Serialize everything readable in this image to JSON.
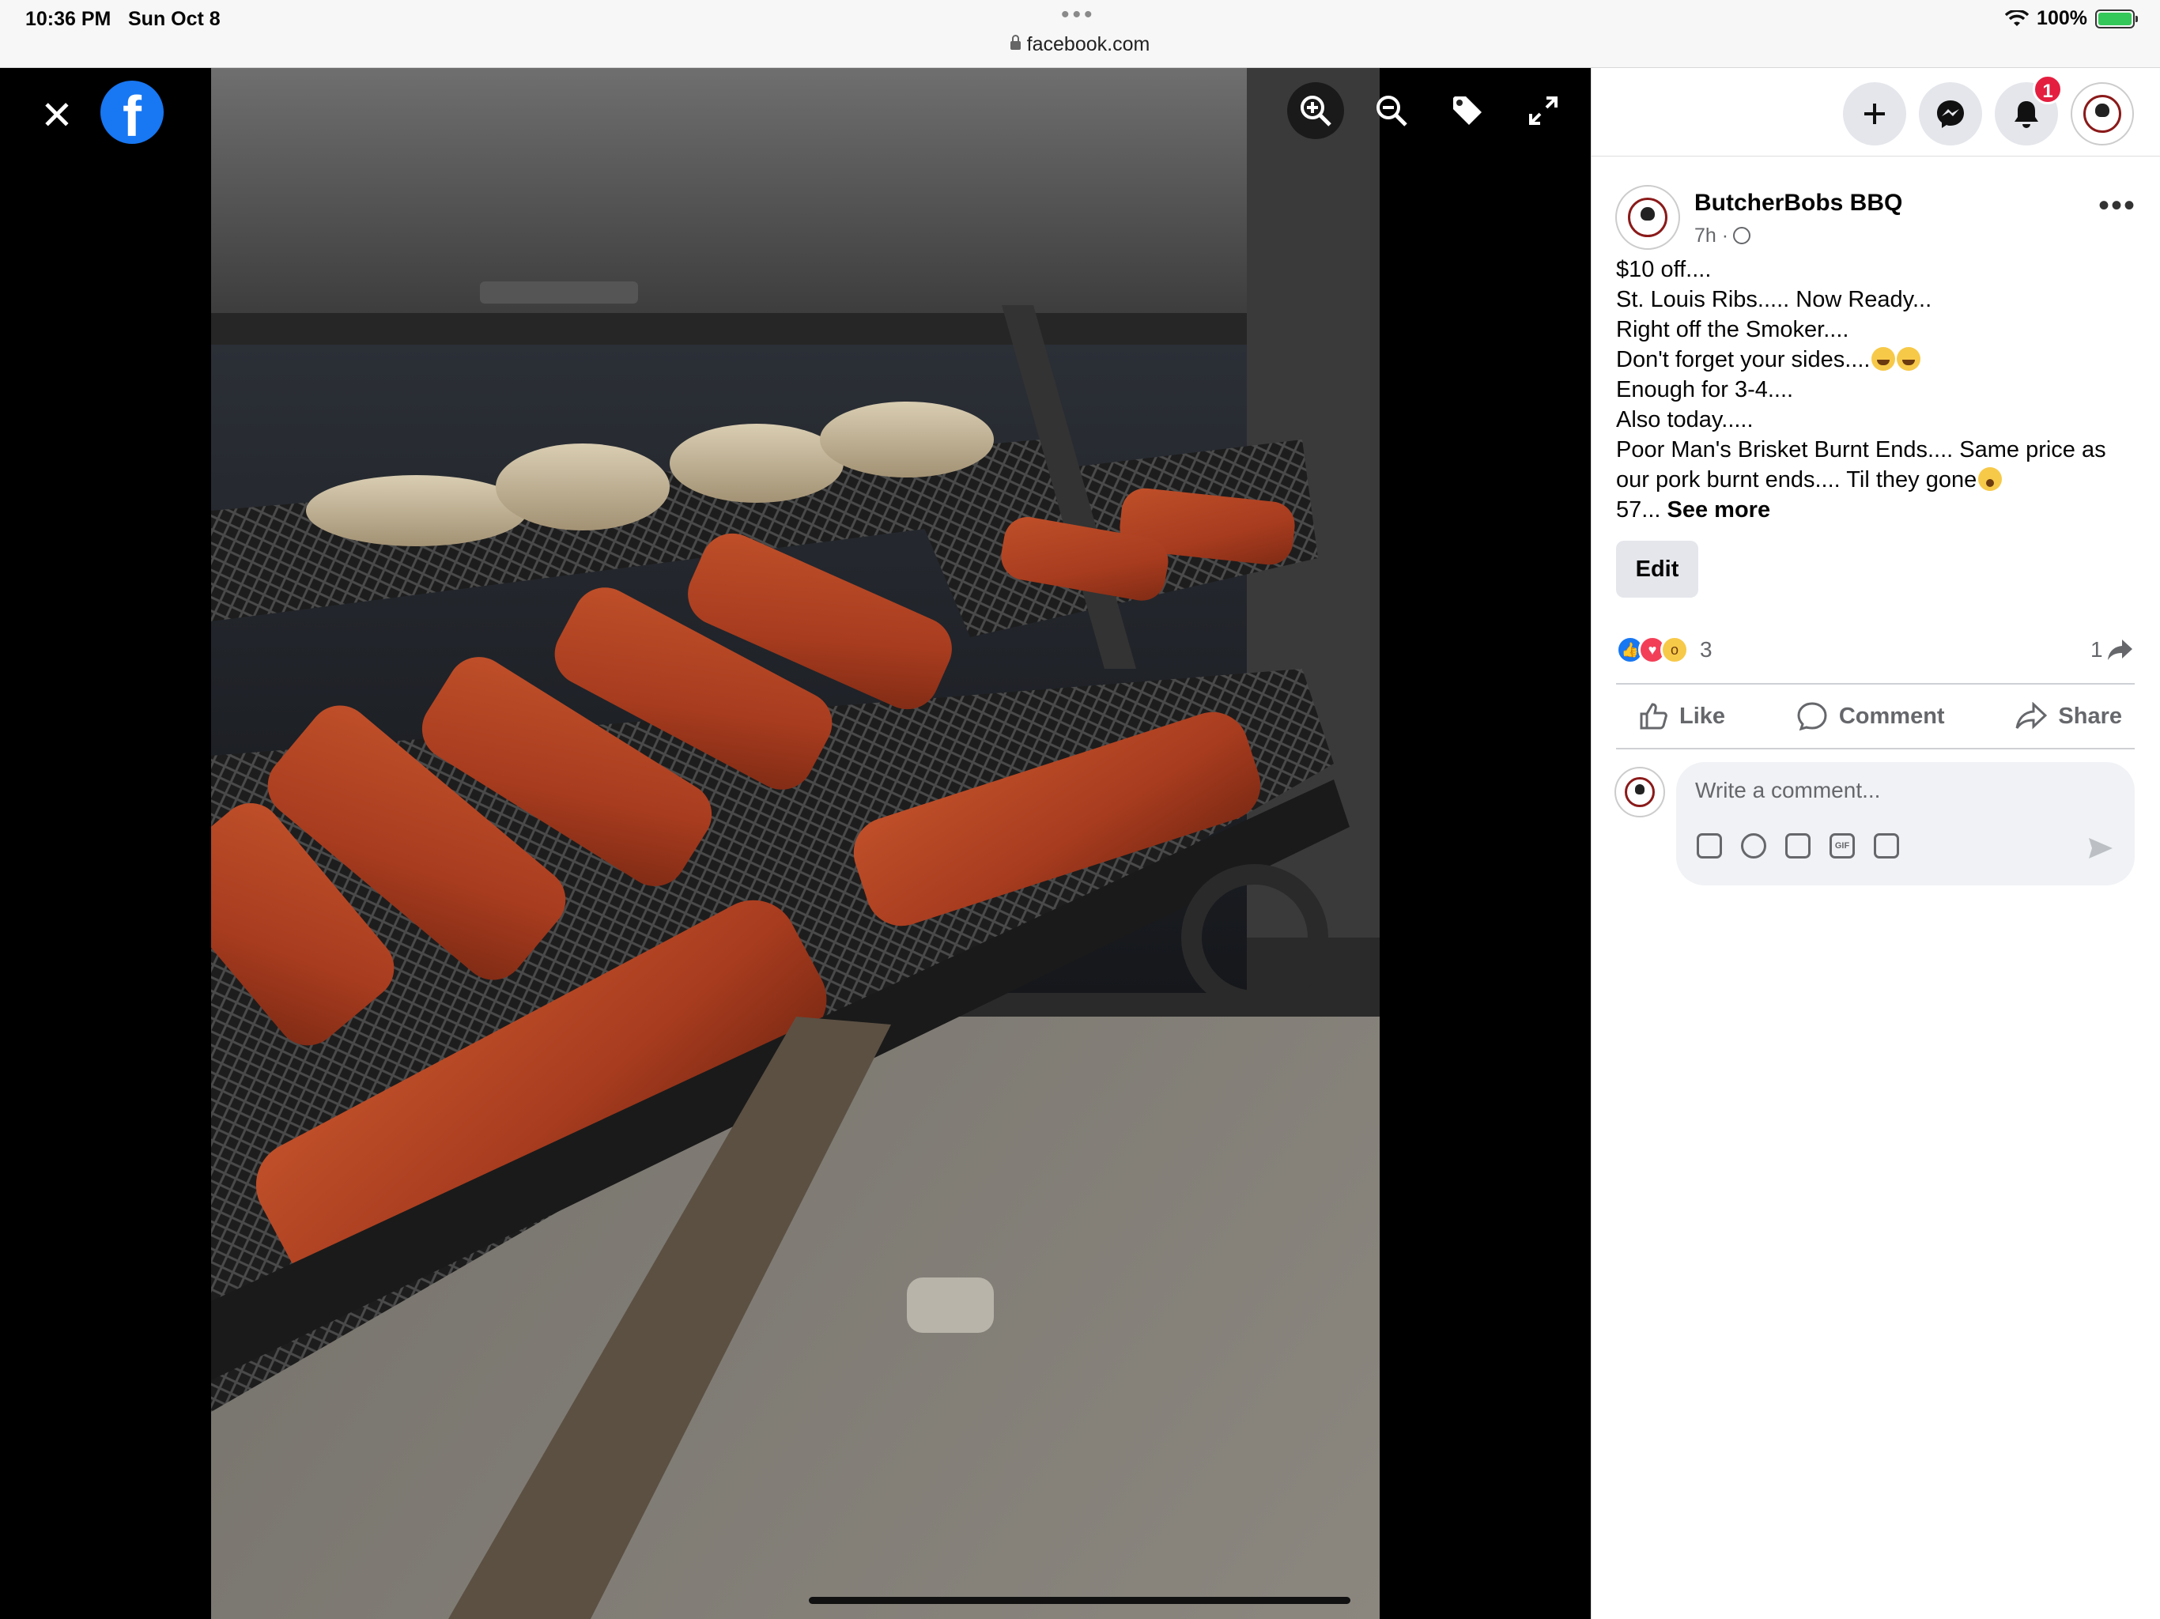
{
  "status_bar": {
    "time": "10:36 PM",
    "date": "Sun Oct 8",
    "url": "facebook.com",
    "battery": "100%",
    "colors": {
      "battery": "#34c759"
    }
  },
  "viewer": {
    "close_icon": "close-icon",
    "logo": "f",
    "tools": [
      "zoom-in-icon",
      "zoom-out-icon",
      "tag-icon",
      "fullscreen-icon"
    ],
    "photo_description": ""
  },
  "top_nav": {
    "notifications_badge": "1",
    "icons": [
      "plus-icon",
      "messenger-icon",
      "bell-icon",
      "account-avatar"
    ]
  },
  "post": {
    "author": "ButcherBobs BBQ",
    "time": "7h ·",
    "lines": [
      "$10 off....",
      "St. Louis Ribs..... Now Ready...",
      "Right off the Smoker....",
      "Don't forget your sides....",
      "Enough for 3-4....",
      "Also today.....",
      "Poor Man's Brisket Burnt Ends.... Same price as",
      "our pork burnt ends.... Til they gone",
      "57..."
    ],
    "see_more": "See more",
    "edit_label": "Edit",
    "reaction_count": "3",
    "share_count": "1",
    "actions": {
      "like": "Like",
      "comment": "Comment",
      "share": "Share"
    },
    "comment_placeholder": "Write a comment...",
    "colors": {
      "brand": "#1877f2",
      "badge": "#e41e3f",
      "secondary_text": "#65676b"
    }
  }
}
